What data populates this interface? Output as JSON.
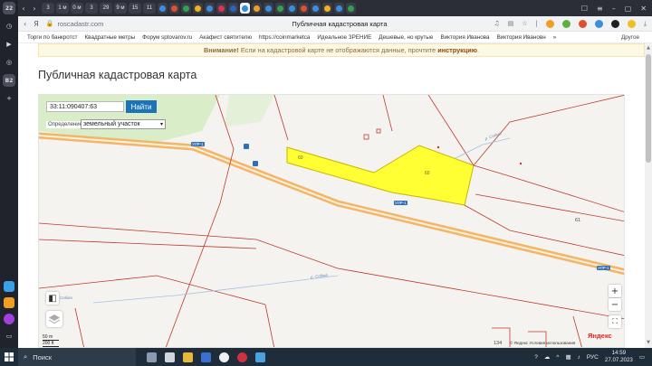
{
  "sidebar": {
    "badge_top": "22",
    "badge_mid": "B2"
  },
  "tabs": {
    "mini": [
      "3",
      "1 м",
      "0 м",
      "3",
      "29",
      "9 м",
      "15",
      "11"
    ],
    "active_title": "Публичная кадастровая карта"
  },
  "address": {
    "url": "roscadastr.com",
    "page_title": "Публичная кадастровая карта"
  },
  "bookmarks": {
    "items": [
      "Торги по банкротст",
      "Квадратные метры",
      "Форум sptovarov.ru",
      "Акафист святителю",
      "https://coinmarketca",
      "Идеальное ЗРЕНИЕ",
      "Дешевые, но крутые",
      "Виктория Иванова",
      "Виктория Ивановн"
    ],
    "more": "»",
    "other": "Другое"
  },
  "page": {
    "warning_strong": "Внимание!",
    "warning_text": " Если на кадастровой карте не отображаются данные, прочтите ",
    "warning_link": "инструкцию",
    "warning_end": ".",
    "heading": "Публичная кадастровая карта"
  },
  "map": {
    "search_value": "33:11:090407:63",
    "find_label": "Найти",
    "definition_label": "Определение",
    "definition_value": "земельный участок",
    "zoom_in": "+",
    "zoom_out": "−",
    "scale_m": "50 m",
    "scale_ft": "200 ft",
    "yandex": "Яндекс",
    "copyright": "© Яндекс  Условия использования",
    "plot_label_1": "60",
    "plot_label_2": "60",
    "road_1": "УЛР-1",
    "road_2": "УЛР-1",
    "road_3": "УЛР-1",
    "river_1": "р. Собма",
    "river_2": "р. Собма",
    "river_3": "р. Собма",
    "num_61": "61",
    "num_134": "134"
  },
  "taskbar": {
    "search_placeholder": "Поиск",
    "lang": "РУС",
    "time": "14:59",
    "date": "27.07.2023"
  },
  "colors": {
    "highlight": "#ffff33",
    "highlight_border": "#c9b400",
    "road": "#f2b56a",
    "boundary": "#c0392b",
    "find_button": "#1b74b8"
  }
}
